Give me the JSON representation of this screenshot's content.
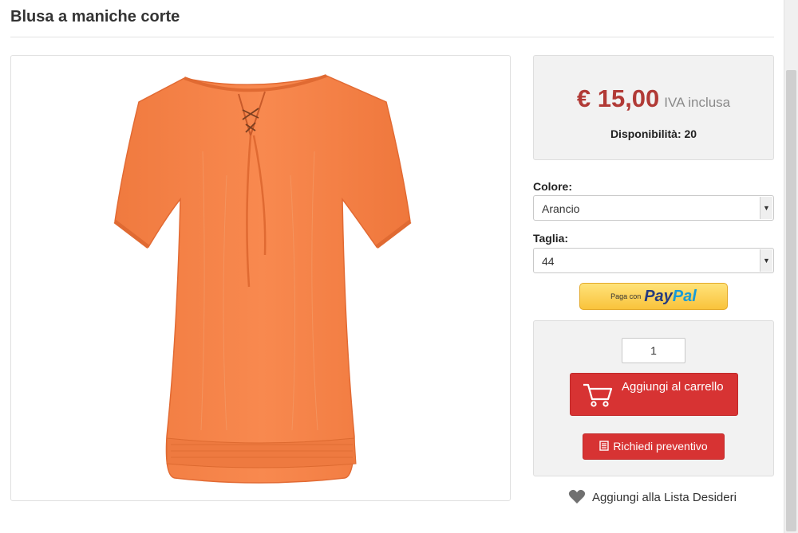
{
  "product": {
    "title": "Blusa a maniche corte",
    "image_alt": "orange-short-sleeve-blouse"
  },
  "price_box": {
    "price": "€ 15,00",
    "vat_label": "IVA inclusa",
    "availability": "Disponibilità: 20"
  },
  "options": {
    "color_label": "Colore:",
    "color_value": "Arancio",
    "size_label": "Taglia:",
    "size_value": "44"
  },
  "paypal": {
    "prefix": "Paga con",
    "brand_pay": "Pay",
    "brand_pal": "Pal"
  },
  "cart": {
    "quantity": "1",
    "add_to_cart": "Aggiungi al carrello",
    "request_quote": "Richiedi preventivo"
  },
  "wishlist": {
    "label": "Aggiungi alla Lista Desideri"
  },
  "colors": {
    "accent_red": "#d73333",
    "price_red": "#b13a36",
    "product_orange": "#f7854a"
  },
  "icons": {
    "cart": "cart-icon",
    "quote": "document-icon",
    "wishlist": "heart-icon",
    "select_caret": "chevron-down-icon"
  }
}
